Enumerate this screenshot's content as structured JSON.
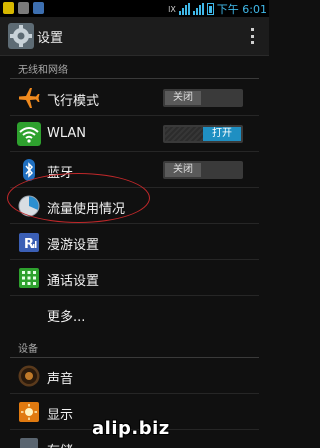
{
  "status_bar": {
    "time": "下午 6:01",
    "network_label": "lX",
    "accent": "#40b8e8"
  },
  "action_bar": {
    "title": "设置",
    "icon": "gear-icon",
    "overflow_icon": "overflow-menu-icon"
  },
  "sections": {
    "wireless": "无线和网络",
    "device": "设备"
  },
  "rows": {
    "airplane": {
      "label": "飞行模式",
      "icon": "airplane-icon",
      "toggle": "关闭",
      "state": "off"
    },
    "wlan": {
      "label": "WLAN",
      "icon": "wifi-icon",
      "toggle": "打开",
      "state": "on"
    },
    "bluetooth": {
      "label": "蓝牙",
      "icon": "bluetooth-icon",
      "toggle": "关闭",
      "state": "off"
    },
    "data_usage": {
      "label": "流量使用情况",
      "icon": "data-usage-icon"
    },
    "roaming": {
      "label": "漫游设置",
      "icon": "roaming-icon"
    },
    "call": {
      "label": "通话设置",
      "icon": "call-settings-icon"
    },
    "more": {
      "label": "更多..."
    },
    "sound": {
      "label": "声音",
      "icon": "speaker-icon"
    },
    "display": {
      "label": "显示",
      "icon": "display-icon"
    },
    "storage": {
      "label": "存储",
      "icon": "storage-icon"
    }
  },
  "colors": {
    "toggle_on": "#1f8fc2",
    "highlight_ring": "#c0282a"
  },
  "watermark": "alip.biz"
}
